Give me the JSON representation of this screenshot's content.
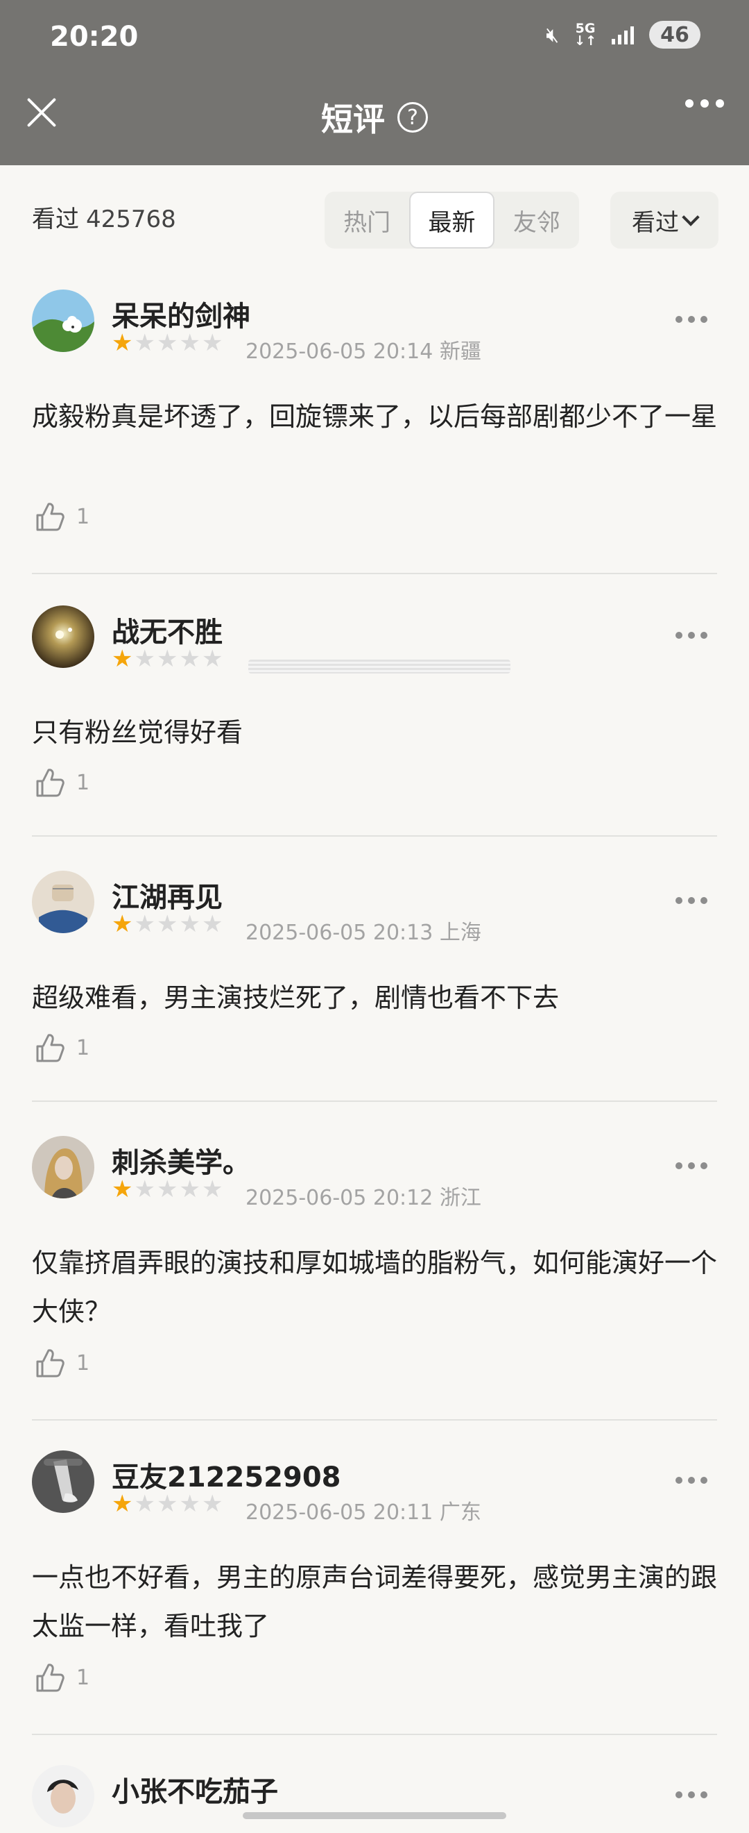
{
  "status_bar": {
    "time": "20:20",
    "network": "5G",
    "battery": "46"
  },
  "header": {
    "title": "短评"
  },
  "filter": {
    "count_label": "看过",
    "count_value": "425768",
    "tabs": [
      "热门",
      "最新",
      "友邻"
    ],
    "active_tab": "最新",
    "dropdown_label": "看过"
  },
  "reviews": [
    {
      "username": "呆呆的剑神",
      "rating": 1,
      "time": "2025-06-05 20:14",
      "location": "新疆",
      "text": "成毅粉真是坏透了，回旋镖来了，以后每部剧都少不了一星",
      "likes": "1"
    },
    {
      "username": "战无不胜",
      "rating": 1,
      "time": "",
      "location": "",
      "text": "只有粉丝觉得好看",
      "likes": "1"
    },
    {
      "username": "江湖再见",
      "rating": 1,
      "time": "2025-06-05 20:13",
      "location": "上海",
      "text": "超级难看，男主演技烂死了，剧情也看不下去",
      "likes": "1"
    },
    {
      "username": "刺杀美学。",
      "rating": 1,
      "time": "2025-06-05 20:12",
      "location": "浙江",
      "text": "仅靠挤眉弄眼的演技和厚如城墙的脂粉气，如何能演好一个大侠？",
      "likes": "1"
    },
    {
      "username": "豆友212252908",
      "rating": 1,
      "time": "2025-06-05 20:11",
      "location": "广东",
      "text": "一点也不好看，男主的原声台词差得要死，感觉男主演的跟太监一样，看吐我了",
      "likes": "1"
    },
    {
      "username": "小张不吃茄子"
    }
  ]
}
